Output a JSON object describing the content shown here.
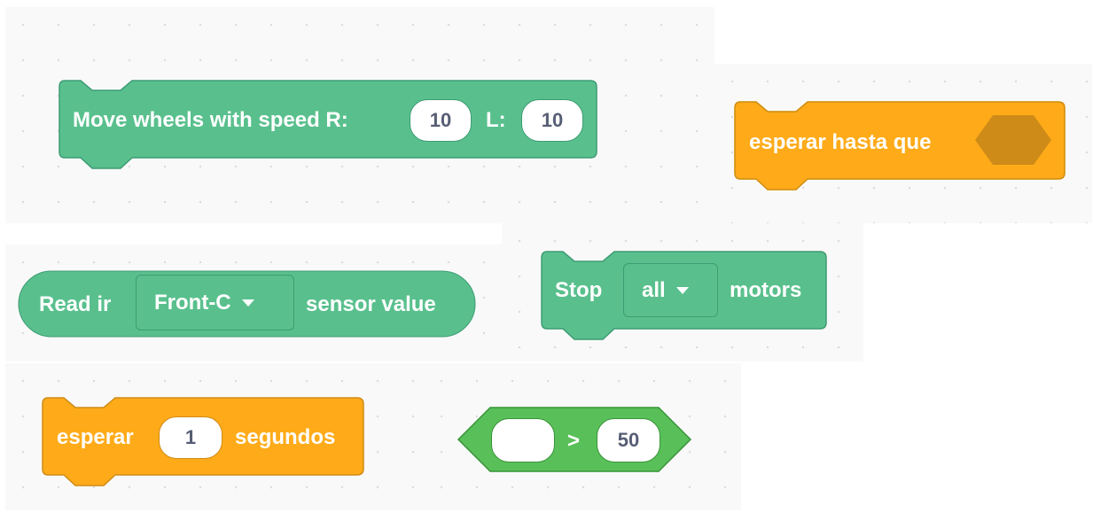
{
  "move_block": {
    "label": "Move wheels with speed R:",
    "r_value": "10",
    "l_label": "L:",
    "l_value": "10"
  },
  "wait_until_block": {
    "label": "esperar hasta que"
  },
  "read_ir_block": {
    "label_start": "Read ir",
    "dropdown_value": "Front-C",
    "label_end": "sensor value"
  },
  "stop_block": {
    "label_start": "Stop",
    "dropdown_value": "all",
    "label_end": "motors"
  },
  "wait_block": {
    "label_start": "esperar",
    "value": "1",
    "label_end": "segundos"
  },
  "compare_block": {
    "left_value": "",
    "operator": ">",
    "right_value": "50"
  },
  "colors": {
    "motion_green": "#59c08d",
    "control_orange": "#ffab19",
    "operator_green": "#59c059",
    "highlight_yellow": "#fff200"
  },
  "icons": {
    "dropdown": "caret-down-icon"
  }
}
